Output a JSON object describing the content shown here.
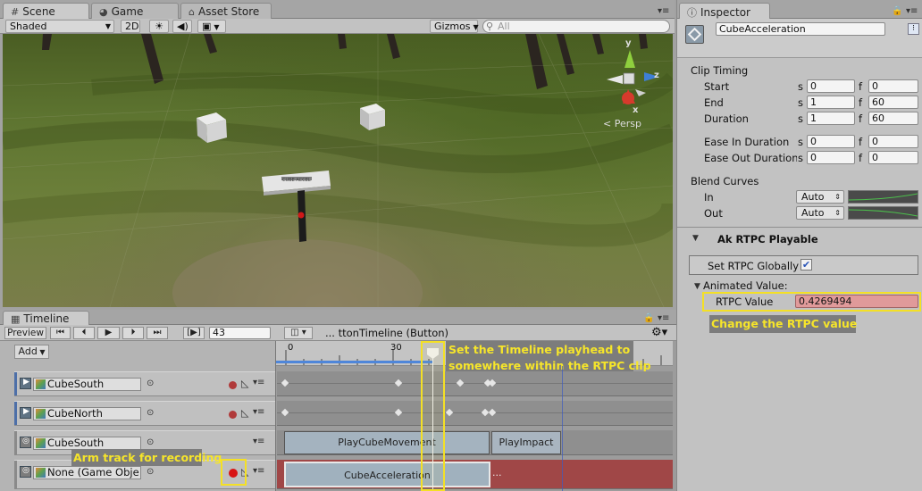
{
  "scene_tabs": [
    {
      "label": "Scene",
      "icon": "hash-grid-icon"
    },
    {
      "label": "Game",
      "icon": "pacman-icon"
    },
    {
      "label": "Asset Store",
      "icon": "store-icon"
    }
  ],
  "scene_toolbar": {
    "shading": "Shaded",
    "mode_2d": "2D",
    "gizmos": "Gizmos",
    "search_placeholder": "All"
  },
  "scene": {
    "persp_label": "Persp",
    "axis_y": "y",
    "axis_x": "x",
    "axis_z": "z",
    "sign_text": "CUBE ACCEL"
  },
  "inspector": {
    "tab": "Inspector",
    "object_name": "CubeAcceleration",
    "clip_timing": "Clip Timing",
    "rows": [
      {
        "label": "Start",
        "s": "0",
        "f": "0"
      },
      {
        "label": "End",
        "s": "1",
        "f": "60"
      },
      {
        "label": "Duration",
        "s": "1",
        "f": "60"
      },
      {
        "label": "Ease In Duration",
        "s": "0",
        "f": "0"
      },
      {
        "label": "Ease Out Duration",
        "s": "0",
        "f": "0"
      }
    ],
    "unit_s": "s",
    "unit_f": "f",
    "blend_curves": "Blend Curves",
    "blend_in": "In",
    "blend_out": "Out",
    "blend_mode": "Auto",
    "component": "Ak RTPC Playable",
    "set_rtpc_globally": "Set RTPC Globally",
    "set_rtpc_globally_checked": true,
    "animated_value": "Animated Value:",
    "rtpc_value_label": "RTPC Value",
    "rtpc_value": "0.4269494",
    "note_change": "Change the RTPC value"
  },
  "timeline": {
    "tab": "Timeline",
    "preview": "Preview",
    "frame": "43",
    "add": "Add",
    "director": "... ttonTimeline (Button)",
    "ruler": [
      "0",
      "30"
    ],
    "tracks": [
      {
        "name": "CubeSouth",
        "kind": "animation",
        "record": true
      },
      {
        "name": "CubeNorth",
        "kind": "animation",
        "record": true
      },
      {
        "name": "CubeSouth",
        "kind": "event",
        "record": false
      },
      {
        "name": "None (Game Obje",
        "kind": "rtpc",
        "record": true
      }
    ],
    "clips": {
      "play_cube_movement": "PlayCubeMovement",
      "play_impact": "PlayImpact",
      "cube_acceleration": "CubeAcceleration",
      "cube_acceleration_tail": "..."
    },
    "note_playhead_1": "Set the Timeline playhead to",
    "note_playhead_2": "somewhere within the RTPC clip",
    "note_arm": "Arm track for recording"
  },
  "colors": {
    "annotation": "#f4e025",
    "record_red": "#c8201e",
    "rtpc_track": "#a04747"
  }
}
